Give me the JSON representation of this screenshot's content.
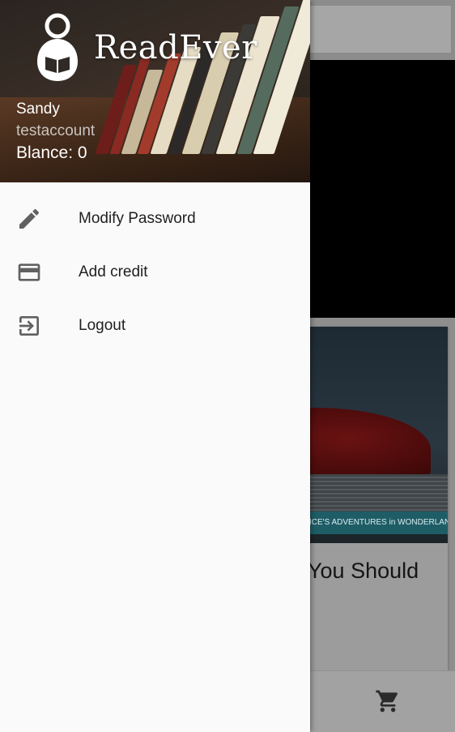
{
  "app": {
    "brand_name": "ReadEver"
  },
  "user": {
    "name": "Sandy",
    "account": "testaccount",
    "balance_label": "Blance: 0"
  },
  "menu": [
    {
      "label": "Modify Password",
      "icon": "pencil-icon"
    },
    {
      "label": "Add credit",
      "icon": "credit-card-icon"
    },
    {
      "label": "Logout",
      "icon": "logout-icon"
    }
  ],
  "background": {
    "card_title": "You Should",
    "card_cover_text": "ICE'S ADVENTURES in WONDERLAND",
    "bottom_nav_icon": "cart-icon"
  },
  "colors": {
    "drawer_bg": "#fafafa",
    "text_primary": "#1f1f1f",
    "icon_gray": "#616161"
  }
}
